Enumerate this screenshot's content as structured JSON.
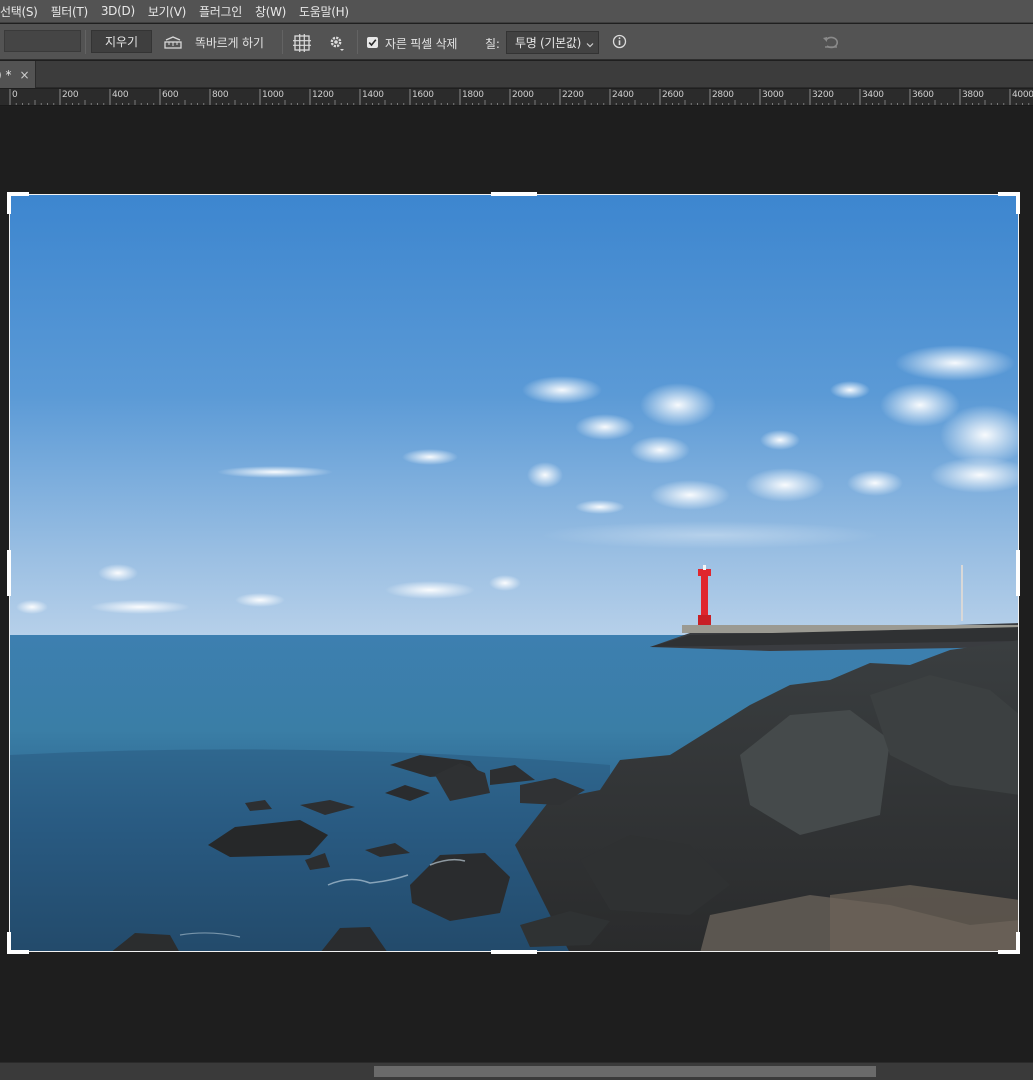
{
  "menu": {
    "items": [
      "선택(S)",
      "필터(T)",
      "3D(D)",
      "보기(V)",
      "플러그인",
      "창(W)",
      "도움말(H)"
    ]
  },
  "options": {
    "clear_button": "지우기",
    "straighten_label": "똑바르게 하기",
    "delete_cropped_checkbox": {
      "label": "자른 픽셀 삭제",
      "checked": true
    },
    "fill_label": "칠:",
    "fill_select_value": "투명 (기본값)",
    "icons": [
      "straighten-icon",
      "grid-overlay-icon",
      "settings-gear-icon",
      "info-icon",
      "reset-icon"
    ]
  },
  "document_tab": {
    "label": ") *",
    "close": "×"
  },
  "ruler": {
    "labels": [
      "0",
      "200",
      "400",
      "600",
      "800",
      "1000",
      "1200",
      "1400",
      "1600",
      "1800",
      "2000",
      "2200",
      "2400",
      "2600",
      "2800",
      "3000",
      "3200",
      "3400",
      "3600",
      "3800",
      "4000"
    ]
  },
  "colors": {
    "chrome": "#535353",
    "canvas": "#1e1e1e",
    "lighthouse": "#e0262e"
  }
}
